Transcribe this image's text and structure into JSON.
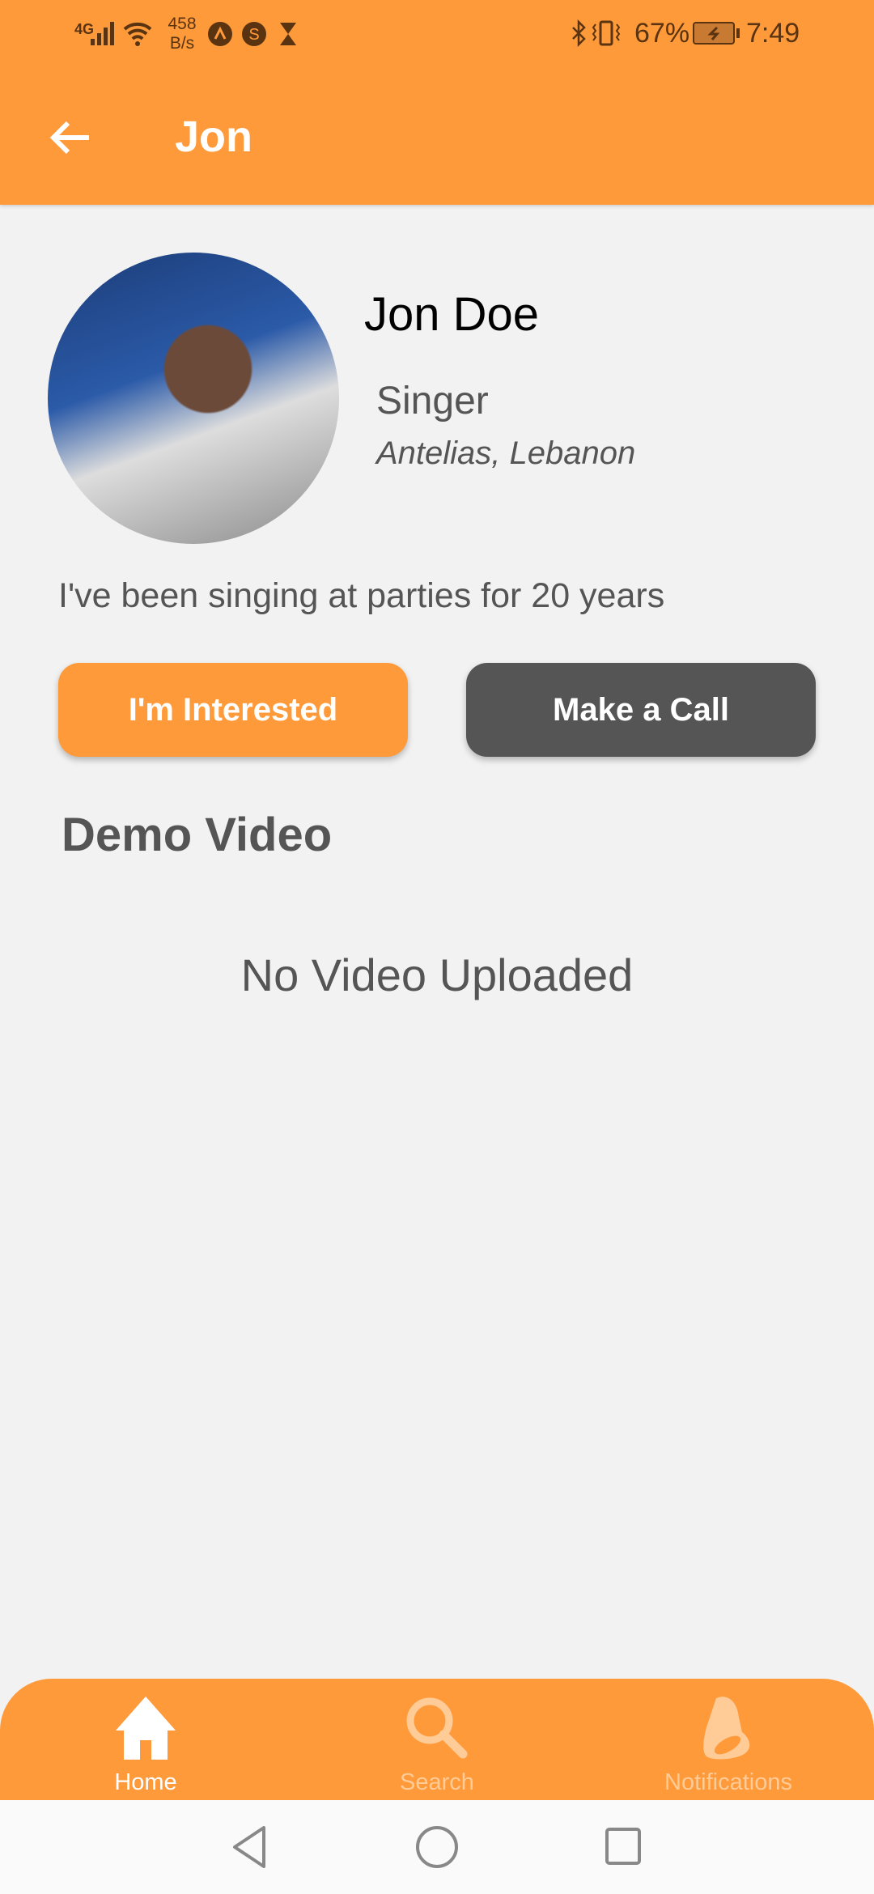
{
  "status_bar": {
    "network": "4G",
    "speed": "458 B/s",
    "battery": "67%",
    "time": "7:49"
  },
  "header": {
    "title": "Jon",
    "back_icon": "arrow-left-icon"
  },
  "profile": {
    "name": "Jon Doe",
    "role": "Singer",
    "location": "Antelias, Lebanon",
    "bio": "I've been singing at parties for 20 years"
  },
  "actions": {
    "interested": "I'm Interested",
    "call": "Make a Call"
  },
  "demo": {
    "heading": "Demo Video",
    "empty": "No Video Uploaded"
  },
  "bottom_nav": {
    "items": [
      {
        "label": "Home",
        "icon": "home-icon",
        "active": true
      },
      {
        "label": "Search",
        "icon": "search-icon",
        "active": false
      },
      {
        "label": "Notifications",
        "icon": "bell-icon",
        "active": false
      }
    ]
  },
  "colors": {
    "accent": "#ff9a3a",
    "dark_button": "#555555",
    "background": "#f2f2f2"
  }
}
